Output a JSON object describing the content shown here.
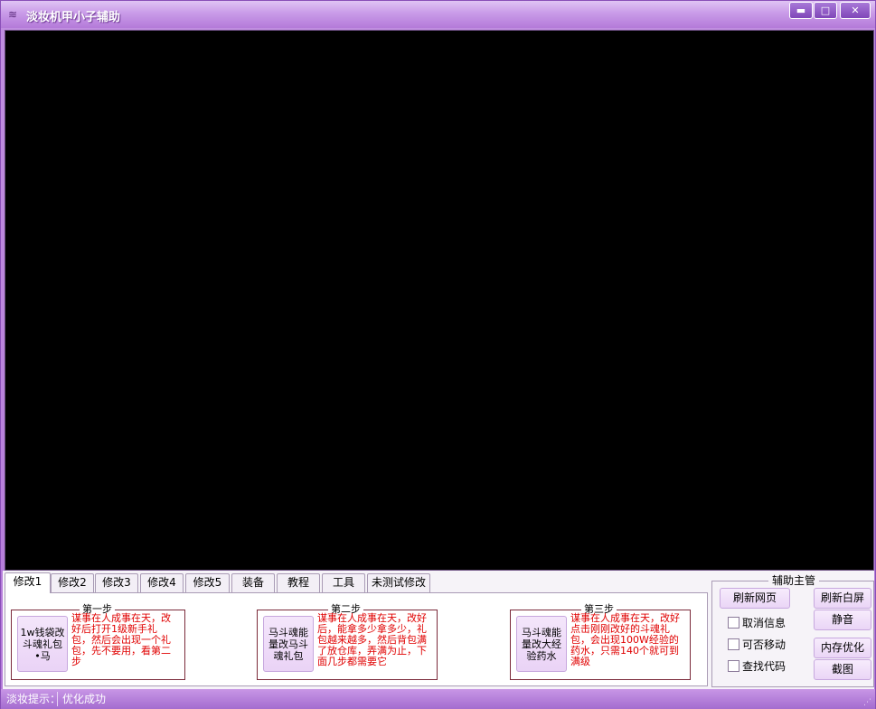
{
  "window": {
    "title": "淡妆机甲小子辅助",
    "icon": "app-icon"
  },
  "titlebar": {
    "minimize": "▬",
    "maximize": "□",
    "close": "✕"
  },
  "tabs": [
    {
      "label": "修改1",
      "active": true
    },
    {
      "label": "修改2"
    },
    {
      "label": "修改3"
    },
    {
      "label": "修改4"
    },
    {
      "label": "修改5"
    },
    {
      "label": "装备"
    },
    {
      "label": "教程"
    },
    {
      "label": "工具"
    },
    {
      "label": "未测试修改"
    }
  ],
  "steps": [
    {
      "title": "第一步",
      "button": "1w钱袋改斗魂礼包•马",
      "desc": "谋事在人成事在天，改好后打开1级新手礼包，然后会出现一个礼包，先不要用，看第二步"
    },
    {
      "title": "第二步",
      "button": "马斗魂能量改马斗魂礼包",
      "desc": "谋事在人成事在天，改好后，能拿多少拿多少，礼包越来越多，然后背包满了放仓库，弄满为止，下面几步都需要它"
    },
    {
      "title": "第三步",
      "button": "马斗魂能量改大经验药水",
      "desc": "谋事在人成事在天，改好点击刚刚改好的斗魂礼包，会出现100W经验的药水，只需140个就可到满级"
    }
  ],
  "side": {
    "title": "辅助主管",
    "refresh_page": "刷新网页",
    "refresh_white": "刷新白屏",
    "mute": "静音",
    "memory_opt": "内存优化",
    "screenshot": "截图",
    "checkboxes": [
      "取消信息",
      "可否移动",
      "查找代码"
    ]
  },
  "status": {
    "label": "淡妆提示：",
    "text": "优化成功"
  }
}
